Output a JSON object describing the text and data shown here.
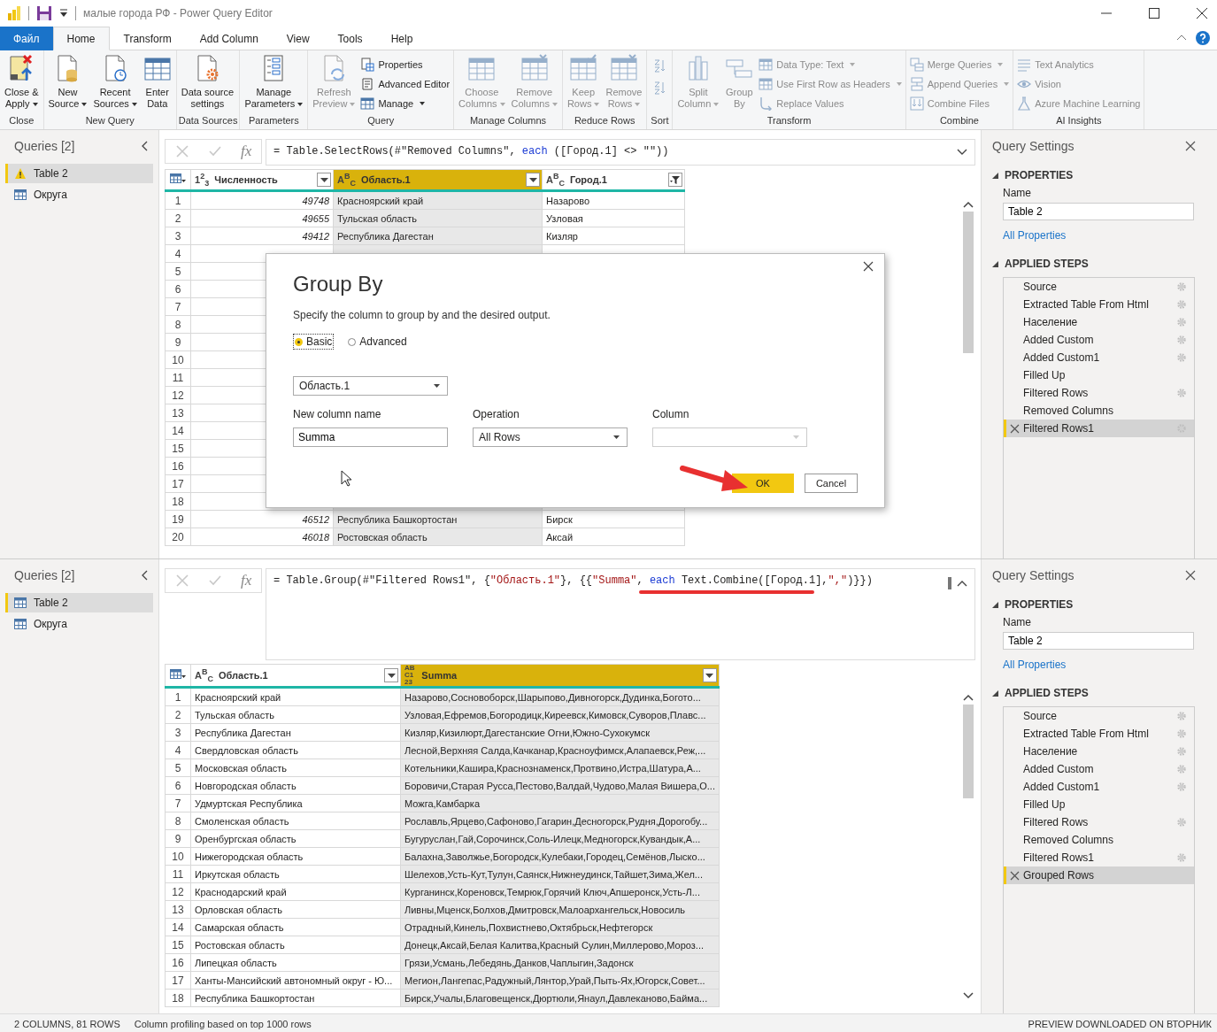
{
  "window": {
    "title": "малые города РФ - Power Query Editor"
  },
  "menu_tabs": [
    {
      "label": "Файл",
      "kind": "file",
      "selected": false
    },
    {
      "label": "Home",
      "kind": "tab",
      "selected": true
    },
    {
      "label": "Transform",
      "kind": "tab",
      "selected": false
    },
    {
      "label": "Add Column",
      "kind": "tab",
      "selected": false
    },
    {
      "label": "View",
      "kind": "tab",
      "selected": false
    },
    {
      "label": "Tools",
      "kind": "tab",
      "selected": false
    },
    {
      "label": "Help",
      "kind": "tab",
      "selected": false
    }
  ],
  "ribbon": {
    "groups": [
      {
        "label": "Close",
        "items": [
          {
            "kind": "large",
            "lines": [
              "Close &",
              "Apply"
            ],
            "dropdown": true,
            "disabled": false
          }
        ]
      },
      {
        "label": "New Query",
        "items": [
          {
            "kind": "large",
            "lines": [
              "New",
              "Source"
            ],
            "dropdown": true,
            "disabled": false
          },
          {
            "kind": "large",
            "lines": [
              "Recent",
              "Sources"
            ],
            "dropdown": true,
            "disabled": false
          },
          {
            "kind": "large",
            "lines": [
              "Enter",
              "Data"
            ],
            "dropdown": false,
            "disabled": false
          }
        ]
      },
      {
        "label": "Data Sources",
        "items": [
          {
            "kind": "large",
            "lines": [
              "Data source",
              "settings"
            ],
            "dropdown": false,
            "disabled": false
          }
        ]
      },
      {
        "label": "Parameters",
        "items": [
          {
            "kind": "large",
            "lines": [
              "Manage",
              "Parameters"
            ],
            "dropdown": true,
            "disabled": false
          }
        ]
      },
      {
        "label": "Query",
        "items": [
          {
            "kind": "large",
            "lines": [
              "Refresh",
              "Preview"
            ],
            "dropdown": true,
            "disabled": true
          },
          {
            "kind": "stack",
            "items": [
              {
                "kind": "small",
                "label": "Properties",
                "dropdown": false,
                "disabled": false
              },
              {
                "kind": "small",
                "label": "Advanced Editor",
                "dropdown": false,
                "disabled": false
              },
              {
                "kind": "small",
                "label": "Manage",
                "dropdown": true,
                "disabled": false
              }
            ]
          }
        ]
      },
      {
        "label": "Manage Columns",
        "items": [
          {
            "kind": "large",
            "lines": [
              "Choose",
              "Columns"
            ],
            "dropdown": true,
            "disabled": true
          },
          {
            "kind": "large",
            "lines": [
              "Remove",
              "Columns"
            ],
            "dropdown": true,
            "disabled": true
          }
        ]
      },
      {
        "label": "Reduce Rows",
        "items": [
          {
            "kind": "large",
            "lines": [
              "Keep",
              "Rows"
            ],
            "dropdown": true,
            "disabled": true
          },
          {
            "kind": "large",
            "lines": [
              "Remove",
              "Rows"
            ],
            "dropdown": true,
            "disabled": true
          }
        ]
      },
      {
        "label": "Sort",
        "items": [
          {
            "kind": "stack",
            "items": [
              {
                "kind": "icon",
                "disabled": true
              },
              {
                "kind": "icon",
                "disabled": true
              }
            ]
          }
        ]
      },
      {
        "label": "Transform",
        "items": [
          {
            "kind": "large",
            "lines": [
              "Split",
              "Column"
            ],
            "dropdown": true,
            "disabled": true
          },
          {
            "kind": "large",
            "lines": [
              "Group",
              "By"
            ],
            "dropdown": false,
            "disabled": true
          },
          {
            "kind": "stack",
            "items": [
              {
                "kind": "small",
                "label": "Data Type: Text",
                "dropdown": true,
                "disabled": true
              },
              {
                "kind": "small",
                "label": "Use First Row as Headers",
                "dropdown": true,
                "disabled": true
              },
              {
                "kind": "small",
                "label": "Replace Values",
                "dropdown": false,
                "disabled": true
              }
            ]
          }
        ]
      },
      {
        "label": "Combine",
        "items": [
          {
            "kind": "stack",
            "items": [
              {
                "kind": "small",
                "label": "Merge Queries",
                "dropdown": true,
                "disabled": true
              },
              {
                "kind": "small",
                "label": "Append Queries",
                "dropdown": true,
                "disabled": true
              },
              {
                "kind": "small",
                "label": "Combine Files",
                "dropdown": false,
                "disabled": true
              }
            ]
          }
        ]
      },
      {
        "label": "AI Insights",
        "items": [
          {
            "kind": "stack",
            "items": [
              {
                "kind": "small",
                "label": "Text Analytics",
                "dropdown": false,
                "disabled": true
              },
              {
                "kind": "small",
                "label": "Vision",
                "dropdown": false,
                "disabled": true
              },
              {
                "kind": "small",
                "label": "Azure Machine Learning",
                "dropdown": false,
                "disabled": true
              }
            ]
          }
        ]
      }
    ]
  },
  "panes": [
    {
      "queries": {
        "title": "Queries [2]",
        "items": [
          {
            "label": "Table 2",
            "kind": "warning",
            "selected": true
          },
          {
            "label": "Округа",
            "kind": "table",
            "selected": false
          }
        ]
      },
      "formula": {
        "fx_label": "fx",
        "expanded": false,
        "tokens": [
          {
            "text": "= Table.SelectRows(#\"Removed Columns\", ",
            "kind": "code"
          },
          {
            "text": "each",
            "kind": "keyword"
          },
          {
            "text": " ([Город.1] <> \"\"))",
            "kind": "code"
          }
        ]
      },
      "table": {
        "columns": [
          {
            "type": {
              "kind": "number",
              "label": "1$^{2}$$_{3}$"
            },
            "name": "Численность",
            "selected": false,
            "filtered": false
          },
          {
            "type": {
              "kind": "text",
              "label": "A$^{B}$$_{C}$"
            },
            "name": "Область.1",
            "selected": true,
            "filtered": false
          },
          {
            "type": {
              "kind": "text",
              "label": "A$^{B}$$_{C}$"
            },
            "name": "Город.1",
            "selected": false,
            "filtered": true
          }
        ],
        "rows": [
          {
            "n": "1",
            "cells": [
              "49748",
              "Красноярский край",
              "Назарово"
            ]
          },
          {
            "n": "2",
            "cells": [
              "49655",
              "Тульская область",
              "Узловая"
            ]
          },
          {
            "n": "3",
            "cells": [
              "49412",
              "Республика Дагестан",
              "Кизляр"
            ]
          },
          {
            "n": "4"
          },
          {
            "n": "5"
          },
          {
            "n": "6"
          },
          {
            "n": "7"
          },
          {
            "n": "8"
          },
          {
            "n": "9"
          },
          {
            "n": "10"
          },
          {
            "n": "11"
          },
          {
            "n": "12"
          },
          {
            "n": "13"
          },
          {
            "n": "14"
          },
          {
            "n": "15"
          },
          {
            "n": "16"
          },
          {
            "n": "17"
          },
          {
            "n": "18"
          },
          {
            "n": "19",
            "cells": [
              "46512",
              "Республика Башкортостан",
              "Бирск"
            ]
          },
          {
            "n": "20",
            "cells": [
              "46018",
              "Ростовская область",
              "Аксай"
            ]
          }
        ]
      },
      "settings": {
        "title": "Query Settings",
        "properties_header": "PROPERTIES",
        "name_label": "Name",
        "name_value": "Table 2",
        "all_properties": "All Properties",
        "steps_header": "APPLIED STEPS",
        "steps": [
          {
            "label": "Source",
            "settings": true,
            "selected": false
          },
          {
            "label": "Extracted Table From Html",
            "settings": true,
            "selected": false
          },
          {
            "label": "Население",
            "settings": true,
            "selected": false
          },
          {
            "label": "Added Custom",
            "settings": true,
            "selected": false
          },
          {
            "label": "Added Custom1",
            "settings": true,
            "selected": false
          },
          {
            "label": "Filled Up",
            "settings": false,
            "selected": false
          },
          {
            "label": "Filtered Rows",
            "settings": true,
            "selected": false
          },
          {
            "label": "Removed Columns",
            "settings": false,
            "selected": false
          },
          {
            "label": "Filtered Rows1",
            "settings": true,
            "selected": true
          }
        ]
      },
      "dialog": {
        "title": "Group By",
        "description": "Specify the column to group by and the desired output.",
        "options": [
          {
            "label": "Basic",
            "selected": true
          },
          {
            "label": "Advanced",
            "selected": false
          }
        ],
        "group_column": "Область.1",
        "new_column_label": "New column name",
        "new_column_value": "Summa",
        "operation_label": "Operation",
        "operation_value": "All Rows",
        "column_label": "Column",
        "column_disabled": true,
        "buttons": [
          {
            "label": "OK",
            "kind": "primary"
          },
          {
            "label": "Cancel",
            "kind": "secondary"
          }
        ]
      }
    },
    {
      "queries": {
        "title": "Queries [2]",
        "items": [
          {
            "label": "Table 2",
            "kind": "table",
            "selected": true
          },
          {
            "label": "Округа",
            "kind": "table",
            "selected": false
          }
        ]
      },
      "formula": {
        "fx_label": "fx",
        "expanded": true,
        "tokens": [
          {
            "text": "= Table.Group(#\"Filtered Rows1\", {",
            "kind": "code"
          },
          {
            "text": "\"Область.1\"",
            "kind": "string"
          },
          {
            "text": "}, {{",
            "kind": "code"
          },
          {
            "text": "\"Summa\"",
            "kind": "string"
          },
          {
            "text": ", ",
            "kind": "code"
          },
          {
            "text": "each",
            "kind": "keyword"
          },
          {
            "text": " Text.Combine([Город.1],",
            "kind": "code"
          },
          {
            "text": "\",\"",
            "kind": "string"
          },
          {
            "text": ")}})",
            "kind": "code"
          }
        ]
      },
      "table": {
        "columns": [
          {
            "type": {
              "kind": "text",
              "label": "A$^{B}$$_{C}$"
            },
            "name": "Область.1",
            "selected": false,
            "filtered": false
          },
          {
            "type": {
              "kind": "any",
              "label": "ABC123"
            },
            "name": "Summa",
            "selected": true,
            "filtered": false
          }
        ],
        "rows": [
          {
            "n": "1",
            "cells": [
              "Красноярский край",
              "Назарово,Сосновоборск,Шарыпово,Дивногорск,Дудинка,Богото..."
            ]
          },
          {
            "n": "2",
            "cells": [
              "Тульская область",
              "Узловая,Ефремов,Богородицк,Киреевск,Кимовск,Суворов,Плавс..."
            ]
          },
          {
            "n": "3",
            "cells": [
              "Республика Дагестан",
              "Кизляр,Кизилюрт,Дагестанские Огни,Южно-Сухокумск"
            ]
          },
          {
            "n": "4",
            "cells": [
              "Свердловская область",
              "Лесной,Верхняя Салда,Качканар,Красноуфимск,Алапаевск,Реж,..."
            ]
          },
          {
            "n": "5",
            "cells": [
              "Московская область",
              "Котельники,Кашира,Краснознаменск,Протвино,Истра,Шатура,А..."
            ]
          },
          {
            "n": "6",
            "cells": [
              "Новгородская область",
              "Боровичи,Старая Русса,Пестово,Валдай,Чудово,Малая Вишера,О..."
            ]
          },
          {
            "n": "7",
            "cells": [
              "Удмуртская Республика",
              "Можга,Камбарка"
            ]
          },
          {
            "n": "8",
            "cells": [
              "Смоленская область",
              "Рославль,Ярцево,Сафоново,Гагарин,Десногорск,Рудня,Дорогобу..."
            ]
          },
          {
            "n": "9",
            "cells": [
              "Оренбургская область",
              "Бугуруслан,Гай,Сорочинск,Соль-Илецк,Медногорск,Кувандык,А..."
            ]
          },
          {
            "n": "10",
            "cells": [
              "Нижегородская область",
              "Балахна,Заволжье,Богородск,Кулебаки,Городец,Семёнов,Лыско..."
            ]
          },
          {
            "n": "11",
            "cells": [
              "Иркутская область",
              "Шелехов,Усть-Кут,Тулун,Саянск,Нижнеудинск,Тайшет,Зима,Жел..."
            ]
          },
          {
            "n": "12",
            "cells": [
              "Краснодарский край",
              "Курганинск,Кореновск,Темрюк,Горячий Ключ,Апшеронск,Усть-Л..."
            ]
          },
          {
            "n": "13",
            "cells": [
              "Орловская область",
              "Ливны,Мценск,Болхов,Дмитровск,Малоархангельск,Новосиль"
            ]
          },
          {
            "n": "14",
            "cells": [
              "Самарская область",
              "Отрадный,Кинель,Похвистнево,Октябрьск,Нефтегорск"
            ]
          },
          {
            "n": "15",
            "cells": [
              "Ростовская область",
              "Донецк,Аксай,Белая Калитва,Красный Сулин,Миллерово,Мороз..."
            ]
          },
          {
            "n": "16",
            "cells": [
              "Липецкая область",
              "Грязи,Усмань,Лебедянь,Данков,Чаплыгин,Задонск"
            ]
          },
          {
            "n": "17",
            "cells": [
              "Ханты-Мансийский автономный округ - Ю...",
              "Мегион,Лангепас,Радужный,Лянтор,Урай,Пыть-Ях,Югорск,Совет..."
            ]
          },
          {
            "n": "18",
            "cells": [
              "Республика Башкортостан",
              "Бирск,Учалы,Благовещенск,Дюртюли,Янаул,Давлеканово,Байма..."
            ]
          }
        ]
      },
      "settings": {
        "title": "Query Settings",
        "properties_header": "PROPERTIES",
        "name_label": "Name",
        "name_value": "Table 2",
        "all_properties": "All Properties",
        "steps_header": "APPLIED STEPS",
        "steps": [
          {
            "label": "Source",
            "settings": true,
            "selected": false
          },
          {
            "label": "Extracted Table From Html",
            "settings": true,
            "selected": false
          },
          {
            "label": "Население",
            "settings": true,
            "selected": false
          },
          {
            "label": "Added Custom",
            "settings": true,
            "selected": false
          },
          {
            "label": "Added Custom1",
            "settings": true,
            "selected": false
          },
          {
            "label": "Filled Up",
            "settings": false,
            "selected": false
          },
          {
            "label": "Filtered Rows",
            "settings": true,
            "selected": false
          },
          {
            "label": "Removed Columns",
            "settings": false,
            "selected": false
          },
          {
            "label": "Filtered Rows1",
            "settings": true,
            "selected": false
          },
          {
            "label": "Grouped Rows",
            "settings": false,
            "selected": true
          }
        ]
      }
    }
  ],
  "status_bar": {
    "left": [
      "2 COLUMNS, 81 ROWS",
      "Column profiling based on top 1000 rows"
    ],
    "right": "PREVIEW DOWNLOADED ON ВТОРНИК"
  }
}
